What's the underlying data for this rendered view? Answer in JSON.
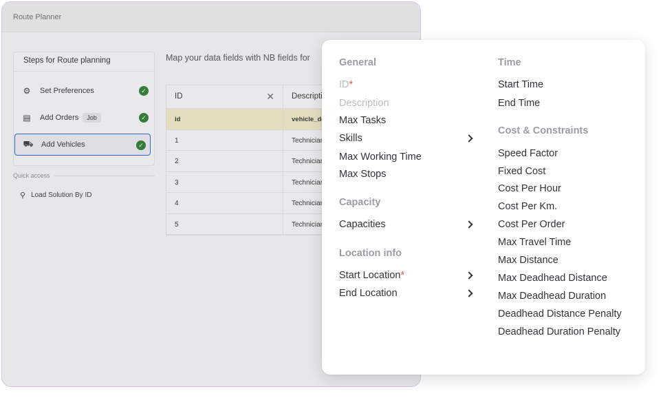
{
  "app": {
    "title": "Route Planner"
  },
  "steps": {
    "header": "Steps for Route planning",
    "items": [
      {
        "label": "Set Preferences",
        "icon": "gear-icon",
        "done": true
      },
      {
        "label": "Add Orders",
        "tag": "Job",
        "icon": "archive-box-icon",
        "done": true
      },
      {
        "label": "Add Vehicles",
        "icon": "truck-icon",
        "done": true,
        "active": true
      }
    ]
  },
  "quick_access": {
    "label": "Quick access",
    "item": "Load Solution By ID"
  },
  "mapping": {
    "instruction": "Map your data fields with NB fields for",
    "table": {
      "headers": [
        "ID",
        "Descripti"
      ],
      "rows": [
        [
          "id",
          "vehicle_de"
        ],
        [
          "1",
          "Technician"
        ],
        [
          "2",
          "Technician"
        ],
        [
          "3",
          "Technician"
        ],
        [
          "4",
          "Technician"
        ],
        [
          "5",
          "Technician"
        ]
      ]
    }
  },
  "dropdown": {
    "left": {
      "general": {
        "heading": "General",
        "items": [
          "ID",
          "Description",
          "Max Tasks",
          "Skills",
          "Max Working Time",
          "Max Stops"
        ]
      },
      "capacity": {
        "heading": "Capacity",
        "items": [
          "Capacities"
        ]
      },
      "location": {
        "heading": "Location info",
        "items": [
          "Start Location",
          "End Location"
        ]
      }
    },
    "right": {
      "time": {
        "heading": "Time",
        "items": [
          "Start Time",
          "End Time"
        ]
      },
      "cost": {
        "heading": "Cost & Constraints",
        "items": [
          "Speed Factor",
          "Fixed Cost",
          "Cost Per Hour",
          "Cost Per Km.",
          "Cost Per Order",
          "Max Travel Time",
          "Max Distance",
          "Max Deadhead Distance",
          "Max Deadhead Duration",
          "Deadhead Distance Penalty",
          "Deadhead Duration Penalty"
        ]
      }
    },
    "required_mark": "*"
  },
  "colors": {
    "accent": "#2f63c8",
    "success": "#2e7d32",
    "required": "#e8545a",
    "highlight_row": "#f2e9c8"
  }
}
